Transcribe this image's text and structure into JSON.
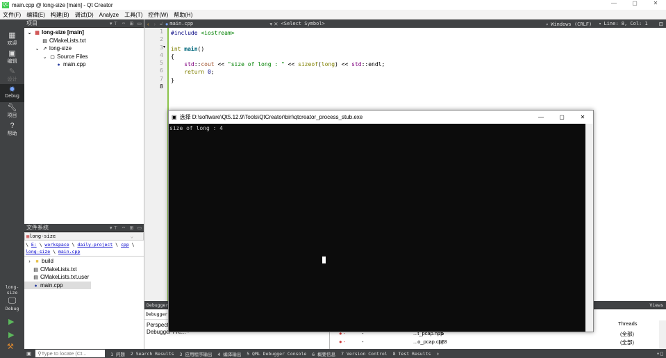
{
  "window": {
    "title": "main.cpp @ long-size [main] - Qt Creator",
    "logo": "QC",
    "minimize": "—",
    "maximize": "▢",
    "close": "✕"
  },
  "menu": [
    "文件(F)",
    "编辑(E)",
    "构建(B)",
    "调试(D)",
    "Analyze",
    "工具(T)",
    "控件(W)",
    "帮助(H)"
  ],
  "modes": [
    {
      "label": "欢迎",
      "icon": "grid-icon"
    },
    {
      "label": "编辑",
      "icon": "edit-icon"
    },
    {
      "label": "设计",
      "icon": "pencil-icon"
    },
    {
      "label": "Debug",
      "icon": "bug-icon",
      "active": true
    },
    {
      "label": "项目",
      "icon": "wrench-icon"
    },
    {
      "label": "帮助",
      "icon": "help-icon"
    }
  ],
  "target": {
    "project": "long-size",
    "config": "Debug"
  },
  "projects": {
    "title": "项目",
    "tree": [
      "long-size [main]",
      "CMakeLists.txt",
      "long-size",
      "Source Files",
      "main.cpp"
    ]
  },
  "filesystem": {
    "title": "文件系统",
    "combo": "long-size",
    "path": [
      "E:",
      "workspace",
      "daily-project",
      "cpp",
      "long-size",
      "main.cpp"
    ],
    "items": [
      "build",
      "CMakeLists.txt",
      "CMakeLists.txt.user",
      "main.cpp"
    ]
  },
  "editor": {
    "file": "main.cpp",
    "symbol": "<Select Symbol>",
    "encoding": "Windows (CRLF)",
    "position": "Line: 8, Col: 1",
    "line_numbers": [
      "1",
      "2",
      "3",
      "4",
      "5",
      "6",
      "7",
      "8"
    ]
  },
  "console": {
    "title": "选择 D:\\software\\Qt5.12.9\\Tools\\QtCreator\\bin\\qtcreator_process_stub.exe",
    "output": "size of long : 4"
  },
  "debugger": {
    "header": "Debugger",
    "views": "Views",
    "sub": "Debugger",
    "rows": [
      "Perspect",
      "Debugger Pre...  -"
    ],
    "threads_header": "Threads",
    "breakpoints": [
      {
        "file": "...t_pcap.hpp",
        "line": "75",
        "threads": "(全部)"
      },
      {
        "file": "...o_pcap.cpp",
        "line": "123",
        "threads": "(全部)"
      }
    ]
  },
  "statusbar": {
    "locate_placeholder": "Type to locate (Ct...",
    "tabs": [
      "1 问题",
      "2 Search Results",
      "3 应用程序输出",
      "4 编译输出",
      "5 QML Debugger Console",
      "6 概要信息",
      "7 Version Control",
      "8 Test Results"
    ]
  }
}
